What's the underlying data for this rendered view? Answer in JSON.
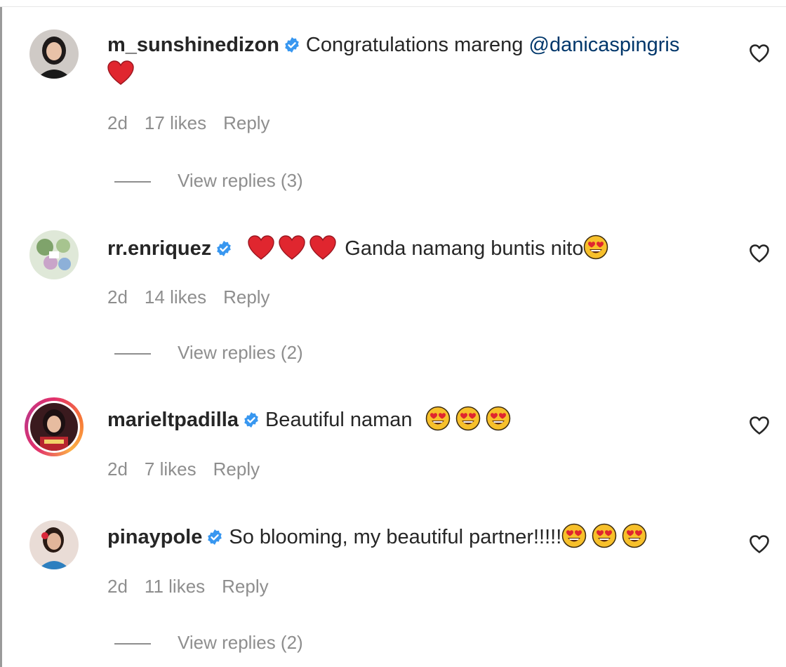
{
  "comments": [
    {
      "username": "m_sunshinedizon",
      "verified": true,
      "text_parts": [
        "Congratulations mareng "
      ],
      "mention": "@danicaspingris",
      "time": "2d",
      "likes": "17 likes",
      "reply_label": "Reply",
      "view_replies": "View replies (3)"
    },
    {
      "username": "rr.enriquez",
      "verified": true,
      "text": "Ganda namang buntis nito",
      "time": "2d",
      "likes": "14 likes",
      "reply_label": "Reply",
      "view_replies": "View replies (2)"
    },
    {
      "username": "marieltpadilla",
      "verified": true,
      "text": "Beautiful naman ",
      "time": "2d",
      "likes": "7 likes",
      "reply_label": "Reply"
    },
    {
      "username": "pinaypole",
      "verified": true,
      "text": "So blooming, my beautiful partner!!!!!",
      "time": "2d",
      "likes": "11 likes",
      "reply_label": "Reply",
      "view_replies": "View replies (2)"
    }
  ],
  "colors": {
    "verified_badge": "#3897f0",
    "meta_text": "#8e8e8e",
    "mention": "#00376b",
    "heart": "#e0262f"
  }
}
